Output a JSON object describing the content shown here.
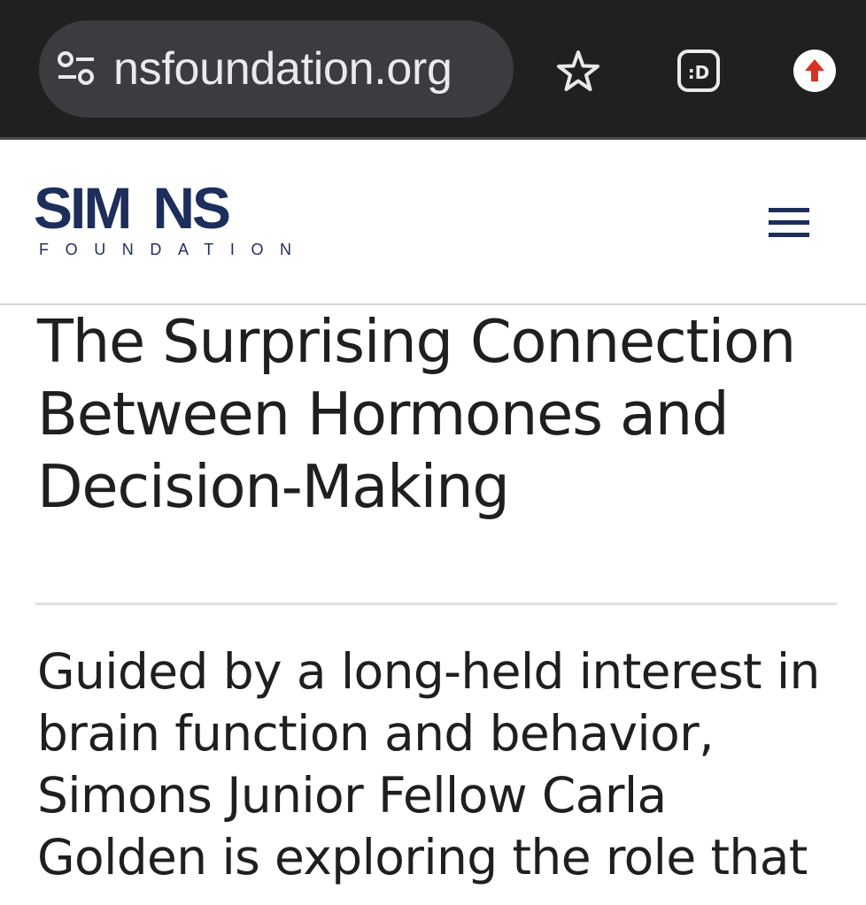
{
  "browser": {
    "url": "nsfoundation.org",
    "icons": [
      "tune-icon",
      "star-icon",
      "reader-mode-icon",
      "upgrade-arrow-icon"
    ],
    "reader_label": ":D",
    "colors": {
      "bar_background": "#202020",
      "pill_background": "#3b3c3f",
      "upgrade_badge": "#d93025"
    }
  },
  "header": {
    "logo_text": "SIM NS",
    "logo_subtext": "FOUNDATION",
    "menu_icon": "hamburger-menu-icon",
    "brand_color": "#1d2d5c"
  },
  "article": {
    "title": "The Surprising Connection Between Hormones and Decision-Making",
    "intro": "Guided by a long-held interest in brain function and behavior, Simons Junior Fellow Carla Golden is exploring the role that"
  }
}
